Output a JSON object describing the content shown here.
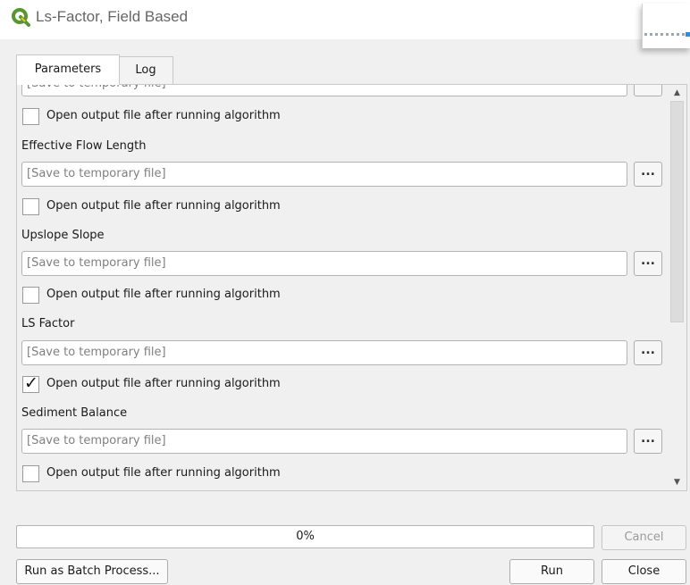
{
  "window": {
    "title": "Ls-Factor, Field Based",
    "icon": "qgis-logo-icon"
  },
  "tabs": [
    {
      "label": "Parameters",
      "active": true
    },
    {
      "label": "Log",
      "active": false
    }
  ],
  "outputs": {
    "partial_field": {
      "placeholder": "[Save to temporary file]",
      "browse": "..."
    },
    "partial_checkbox": {
      "label": "Open output file after running algorithm",
      "checked": false
    },
    "items": [
      {
        "label": "Effective Flow Length",
        "field": "[Save to temporary file]",
        "browse": "...",
        "open_label": "Open output file after running algorithm",
        "checked": false
      },
      {
        "label": "Upslope Slope",
        "field": "[Save to temporary file]",
        "browse": "...",
        "open_label": "Open output file after running algorithm",
        "checked": false
      },
      {
        "label": "LS Factor",
        "field": "[Save to temporary file]",
        "browse": "...",
        "open_label": "Open output file after running algorithm",
        "checked": true
      },
      {
        "label": "Sediment Balance",
        "field": "[Save to temporary file]",
        "browse": "...",
        "open_label": "Open output file after running algorithm",
        "checked": false
      }
    ]
  },
  "progress": {
    "text": "0%",
    "value": 0
  },
  "buttons": {
    "cancel": "Cancel",
    "batch": "Run as Batch Process...",
    "run": "Run",
    "close": "Close"
  },
  "colors": {
    "qgis_green": "#589632",
    "qgis_yellow": "#f0c419",
    "progress_fill": "#3daee9"
  }
}
